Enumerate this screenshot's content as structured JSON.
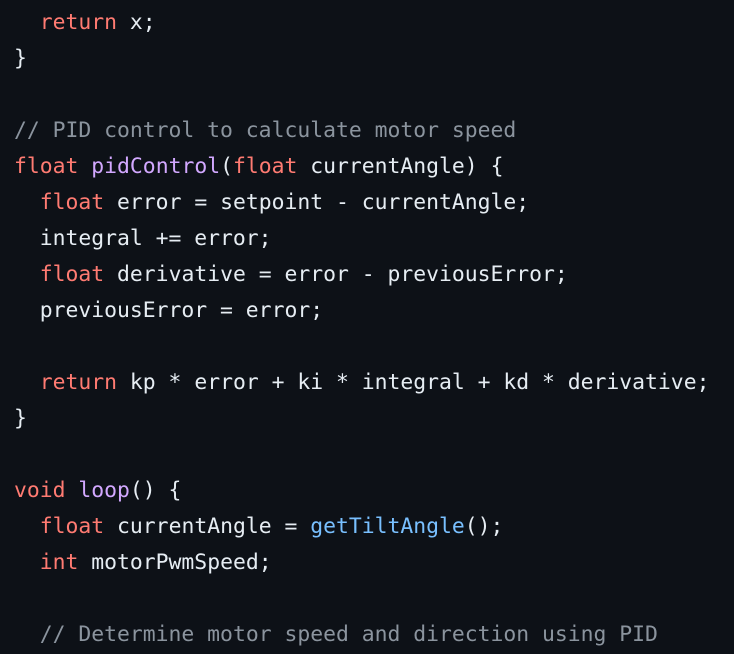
{
  "code": {
    "lines": [
      [
        {
          "t": "  "
        },
        {
          "t": "return",
          "k": "kw"
        },
        {
          "t": " x;"
        }
      ],
      [
        {
          "t": "}"
        }
      ],
      [],
      [
        {
          "t": "// PID control to calculate motor speed",
          "k": "cm"
        }
      ],
      [
        {
          "t": "float",
          "k": "kw"
        },
        {
          "t": " "
        },
        {
          "t": "pidControl",
          "k": "fn"
        },
        {
          "t": "("
        },
        {
          "t": "float",
          "k": "kw"
        },
        {
          "t": " currentAngle) {"
        }
      ],
      [
        {
          "t": "  "
        },
        {
          "t": "float",
          "k": "kw"
        },
        {
          "t": " error = setpoint - currentAngle;"
        }
      ],
      [
        {
          "t": "  integral += error;"
        }
      ],
      [
        {
          "t": "  "
        },
        {
          "t": "float",
          "k": "kw"
        },
        {
          "t": " derivative = error - previousError;"
        }
      ],
      [
        {
          "t": "  previousError = error;"
        }
      ],
      [],
      [
        {
          "t": "  "
        },
        {
          "t": "return",
          "k": "kw"
        },
        {
          "t": " kp * error + ki * integral + kd * derivative;"
        }
      ],
      [
        {
          "t": "}"
        }
      ],
      [],
      [
        {
          "t": "void",
          "k": "kw"
        },
        {
          "t": " "
        },
        {
          "t": "loop",
          "k": "fn"
        },
        {
          "t": "() {"
        }
      ],
      [
        {
          "t": "  "
        },
        {
          "t": "float",
          "k": "kw"
        },
        {
          "t": " currentAngle = "
        },
        {
          "t": "getTiltAngle",
          "k": "call"
        },
        {
          "t": "();"
        }
      ],
      [
        {
          "t": "  "
        },
        {
          "t": "int",
          "k": "kw"
        },
        {
          "t": " motorPwmSpeed;"
        }
      ],
      [],
      [
        {
          "t": "  "
        },
        {
          "t": "// Determine motor speed and direction using PID",
          "k": "cm"
        }
      ]
    ]
  },
  "colors": {
    "background": "#0d1117",
    "text": "#e6edf3",
    "keyword": "#ff7b72",
    "function": "#d2a8ff",
    "call": "#79c0ff",
    "comment": "#8b949e"
  }
}
